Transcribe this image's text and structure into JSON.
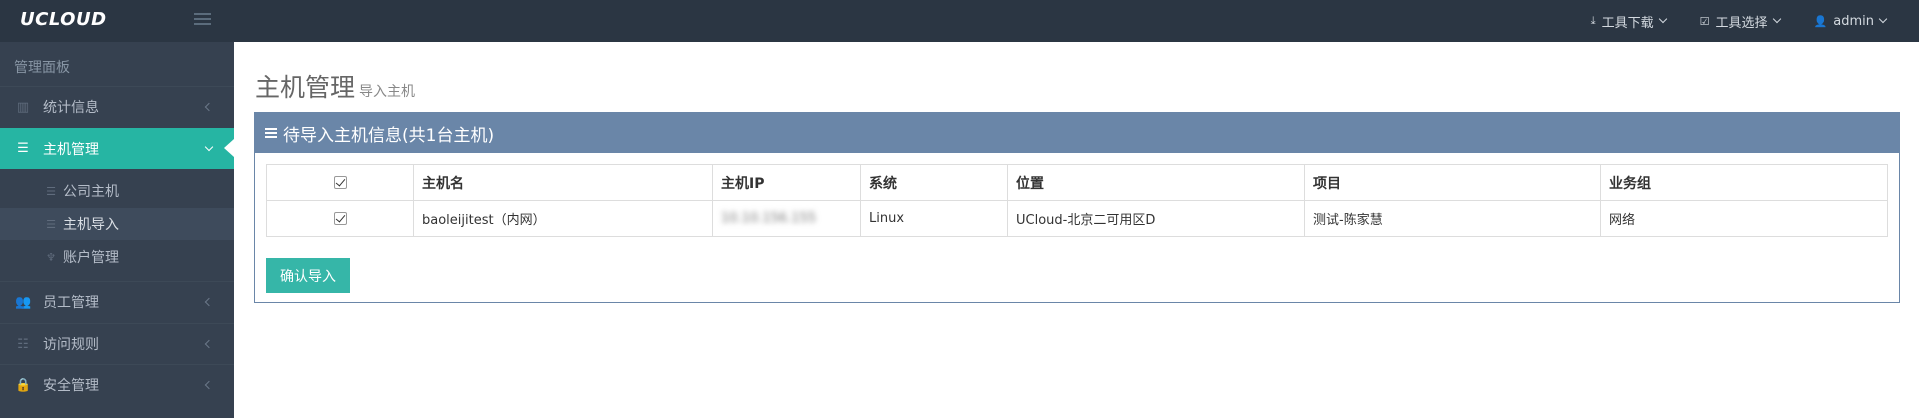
{
  "brand": {
    "logo": "UCLOUD"
  },
  "topnav": [
    {
      "label": "工具下载",
      "icon": "download-icon"
    },
    {
      "label": "工具选择",
      "icon": "checkbox-icon"
    },
    {
      "label": "admin",
      "icon": "user-icon"
    }
  ],
  "sidebar": {
    "title": "管理面板",
    "items": [
      {
        "label": "统计信息",
        "icon": "bar-chart-icon"
      },
      {
        "label": "主机管理",
        "icon": "server-icon"
      },
      {
        "label": "员工管理",
        "icon": "users-icon"
      },
      {
        "label": "访问规则",
        "icon": "list-icon"
      },
      {
        "label": "安全管理",
        "icon": "lock-icon"
      }
    ],
    "subitems": [
      {
        "label": "公司主机",
        "icon": "server-icon"
      },
      {
        "label": "主机导入",
        "icon": "server-icon"
      },
      {
        "label": "账户管理",
        "icon": "sitemap-icon"
      }
    ]
  },
  "page": {
    "title": "主机管理",
    "subtitle": "导入主机"
  },
  "panel": {
    "title": "待导入主机信息(共1台主机)",
    "columns": [
      "主机名",
      "主机IP",
      "系统",
      "位置",
      "项目",
      "业务组"
    ],
    "rows": [
      {
        "hostname": "baoleijitest（内网）",
        "ip": "10.10.156.155",
        "os": "Linux",
        "location": "UCloud-北京二可用区D",
        "project": "测试-陈家慧",
        "group": "网络"
      }
    ],
    "confirm_label": "确认导入"
  },
  "colors": {
    "topbar": "#2b3643",
    "sidebar": "#364150",
    "active": "#26b5a3",
    "panel": "#6a86a8",
    "button": "#36b6a8"
  }
}
